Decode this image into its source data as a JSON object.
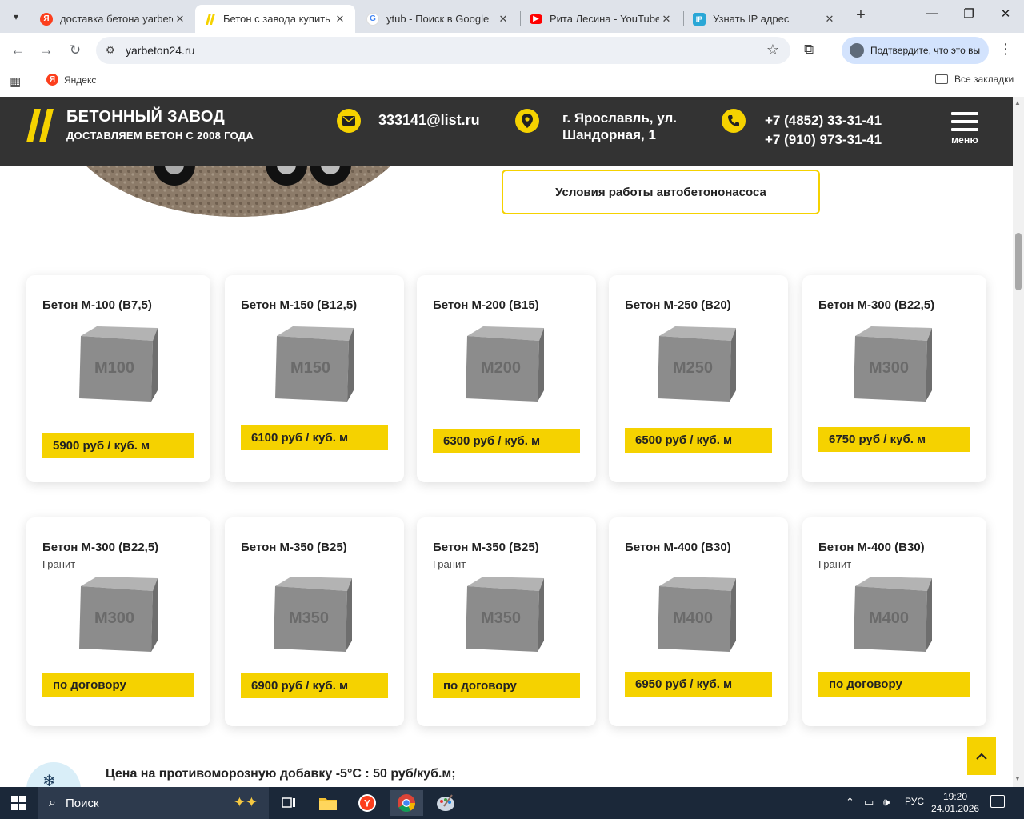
{
  "browser": {
    "tabs": [
      {
        "title": "доставка бетона yarbeto",
        "favicon": "yandex-favicon",
        "active": false
      },
      {
        "title": "Бетон с завода купить в",
        "favicon": "site-favicon",
        "active": true
      },
      {
        "title": "ytub - Поиск в Google",
        "favicon": "google-favicon",
        "active": false
      },
      {
        "title": "Рита Лесина - YouTube",
        "favicon": "youtube-favicon",
        "active": false
      },
      {
        "title": "Узнать IP адрес",
        "favicon": "ip-favicon",
        "active": false
      }
    ],
    "url": "yarbeton24.ru",
    "profile_label": "Подтвердите, что это вы",
    "bookmarks": [
      {
        "label": "Яндекс"
      }
    ],
    "all_bookmarks_label": "Все закладки"
  },
  "header": {
    "title": "БЕТОННЫЙ ЗАВОД",
    "subtitle": "ДОСТАВЛЯЕМ БЕТОН С 2008 ГОДА",
    "email": "333141@list.ru",
    "address_line1": "г. Ярославль, ул.",
    "address_line2": "Шандорная, 1",
    "phone1": "+7 (4852) 33-31-41",
    "phone2": "+7 (910) 973-31-41",
    "menu_label": "меню",
    "accent_color": "#f5d200",
    "bg_color": "#333333"
  },
  "conditions_button": "Условия работы автобетононасоса",
  "products": [
    {
      "title": "Бетон М-100 (В7,5)",
      "subtitle": "",
      "cube_label": "M100",
      "price": "5900 руб / куб. м"
    },
    {
      "title": "Бетон М-150 (В12,5)",
      "subtitle": "",
      "cube_label": "M150",
      "price": "6100 руб / куб. м"
    },
    {
      "title": "Бетон М-200 (В15)",
      "subtitle": "",
      "cube_label": "M200",
      "price": "6300 руб / куб. м"
    },
    {
      "title": "Бетон М-250 (В20)",
      "subtitle": "",
      "cube_label": "M250",
      "price": "6500 руб / куб. м"
    },
    {
      "title": "Бетон М-300 (В22,5)",
      "subtitle": "",
      "cube_label": "M300",
      "price": "6750 руб / куб. м"
    },
    {
      "title": "Бетон М-300 (В22,5)",
      "subtitle": "Гранит",
      "cube_label": "M300",
      "price": "по договору"
    },
    {
      "title": "Бетон М-350 (В25)",
      "subtitle": "",
      "cube_label": "M350",
      "price": "6900 руб / куб. м"
    },
    {
      "title": "Бетон М-350 (В25)",
      "subtitle": "Гранит",
      "cube_label": "M350",
      "price": "по договору"
    },
    {
      "title": "Бетон М-400 (В30)",
      "subtitle": "",
      "cube_label": "M400",
      "price": "6950 руб / куб. м"
    },
    {
      "title": "Бетон М-400 (В30)",
      "subtitle": "Гранит",
      "cube_label": "M400",
      "price": "по договору"
    }
  ],
  "frost_text": "Цена на противоморозную добавку -5°C : 50 руб/куб.м;",
  "taskbar": {
    "search_placeholder": "Поиск",
    "language": "РУС",
    "time": "19:20",
    "date": "24.01.2026"
  }
}
